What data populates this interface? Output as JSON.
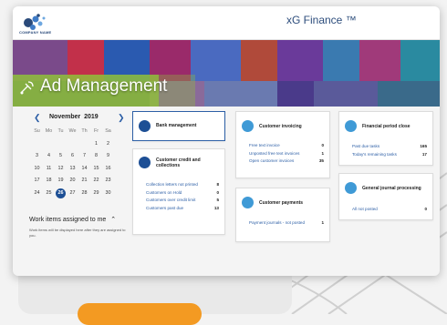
{
  "header": {
    "logo_text": "COMPANY NAME",
    "app_title": "xG Finance ™"
  },
  "banner": {
    "title": "Ad Management"
  },
  "colors": {
    "brand_blue": "#1d4f95",
    "link_blue": "#2d5fa6",
    "accent_orange": "#f39a22",
    "banner_green": "#8fbf3a"
  },
  "calendar": {
    "month": "November",
    "year": "2019",
    "prev_icon": "chevron-left-icon",
    "next_icon": "chevron-right-icon",
    "days_of_week": [
      "Su",
      "Mo",
      "Tu",
      "We",
      "Th",
      "Fr",
      "Sa"
    ],
    "weeks": [
      [
        "",
        "",
        "",
        "",
        "",
        "1",
        "2"
      ],
      [
        "3",
        "4",
        "5",
        "6",
        "7",
        "8",
        "9"
      ],
      [
        "10",
        "11",
        "12",
        "13",
        "14",
        "15",
        "16"
      ],
      [
        "17",
        "18",
        "19",
        "20",
        "21",
        "22",
        "23"
      ],
      [
        "24",
        "25",
        "26",
        "27",
        "28",
        "29",
        "30"
      ]
    ],
    "today": "26"
  },
  "work_items": {
    "title": "Work items assigned to me",
    "description": "Work items will be displayed here after they are assigned to you."
  },
  "tiles": {
    "bank": {
      "title": "Bank management"
    },
    "credit": {
      "title": "Customer credit and collections",
      "rows": [
        {
          "label": "Collection letters not printed",
          "value": "8"
        },
        {
          "label": "Customers on Hold",
          "value": "0"
        },
        {
          "label": "Customers over credit limit",
          "value": "5"
        },
        {
          "label": "Customers past due",
          "value": "13"
        }
      ]
    },
    "invoicing": {
      "title": "Customer invoicing",
      "rows": [
        {
          "label": "Free text invoice",
          "value": "0"
        },
        {
          "label": "Unposted free text invoices",
          "value": "1"
        },
        {
          "label": "Open customer invoices",
          "value": "35"
        }
      ]
    },
    "payments": {
      "title": "Customer payments",
      "rows": [
        {
          "label": "Payment journals - not posted",
          "value": "1"
        }
      ]
    },
    "period": {
      "title": "Financial period close",
      "rows": [
        {
          "label": "Past due tasks",
          "value": "165"
        },
        {
          "label": "Today's remaining tasks",
          "value": "17"
        }
      ]
    },
    "journal": {
      "title": "General journal processing",
      "rows": [
        {
          "label": "All not posted",
          "value": "0"
        }
      ]
    }
  }
}
